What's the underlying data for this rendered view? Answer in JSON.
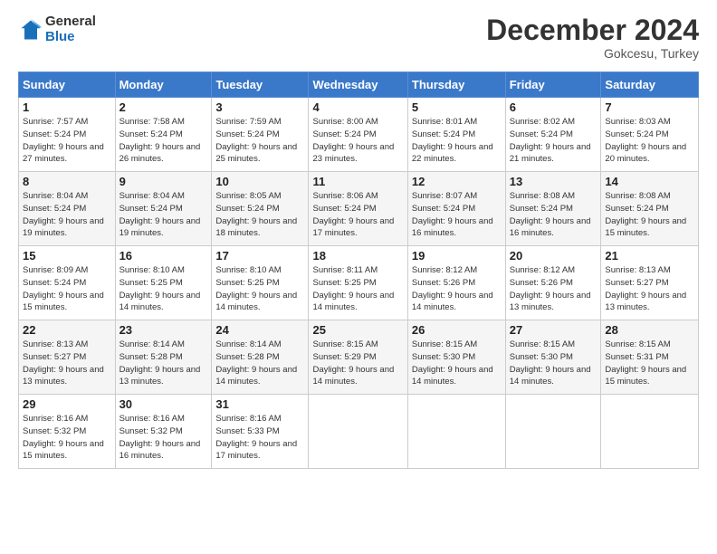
{
  "header": {
    "logo_line1": "General",
    "logo_line2": "Blue",
    "month": "December 2024",
    "location": "Gokcesu, Turkey"
  },
  "days_of_week": [
    "Sunday",
    "Monday",
    "Tuesday",
    "Wednesday",
    "Thursday",
    "Friday",
    "Saturday"
  ],
  "weeks": [
    [
      {
        "num": "1",
        "sunrise": "7:57 AM",
        "sunset": "5:24 PM",
        "daylight": "9 hours and 27 minutes."
      },
      {
        "num": "2",
        "sunrise": "7:58 AM",
        "sunset": "5:24 PM",
        "daylight": "9 hours and 26 minutes."
      },
      {
        "num": "3",
        "sunrise": "7:59 AM",
        "sunset": "5:24 PM",
        "daylight": "9 hours and 25 minutes."
      },
      {
        "num": "4",
        "sunrise": "8:00 AM",
        "sunset": "5:24 PM",
        "daylight": "9 hours and 23 minutes."
      },
      {
        "num": "5",
        "sunrise": "8:01 AM",
        "sunset": "5:24 PM",
        "daylight": "9 hours and 22 minutes."
      },
      {
        "num": "6",
        "sunrise": "8:02 AM",
        "sunset": "5:24 PM",
        "daylight": "9 hours and 21 minutes."
      },
      {
        "num": "7",
        "sunrise": "8:03 AM",
        "sunset": "5:24 PM",
        "daylight": "9 hours and 20 minutes."
      }
    ],
    [
      {
        "num": "8",
        "sunrise": "8:04 AM",
        "sunset": "5:24 PM",
        "daylight": "9 hours and 19 minutes."
      },
      {
        "num": "9",
        "sunrise": "8:04 AM",
        "sunset": "5:24 PM",
        "daylight": "9 hours and 19 minutes."
      },
      {
        "num": "10",
        "sunrise": "8:05 AM",
        "sunset": "5:24 PM",
        "daylight": "9 hours and 18 minutes."
      },
      {
        "num": "11",
        "sunrise": "8:06 AM",
        "sunset": "5:24 PM",
        "daylight": "9 hours and 17 minutes."
      },
      {
        "num": "12",
        "sunrise": "8:07 AM",
        "sunset": "5:24 PM",
        "daylight": "9 hours and 16 minutes."
      },
      {
        "num": "13",
        "sunrise": "8:08 AM",
        "sunset": "5:24 PM",
        "daylight": "9 hours and 16 minutes."
      },
      {
        "num": "14",
        "sunrise": "8:08 AM",
        "sunset": "5:24 PM",
        "daylight": "9 hours and 15 minutes."
      }
    ],
    [
      {
        "num": "15",
        "sunrise": "8:09 AM",
        "sunset": "5:24 PM",
        "daylight": "9 hours and 15 minutes."
      },
      {
        "num": "16",
        "sunrise": "8:10 AM",
        "sunset": "5:25 PM",
        "daylight": "9 hours and 14 minutes."
      },
      {
        "num": "17",
        "sunrise": "8:10 AM",
        "sunset": "5:25 PM",
        "daylight": "9 hours and 14 minutes."
      },
      {
        "num": "18",
        "sunrise": "8:11 AM",
        "sunset": "5:25 PM",
        "daylight": "9 hours and 14 minutes."
      },
      {
        "num": "19",
        "sunrise": "8:12 AM",
        "sunset": "5:26 PM",
        "daylight": "9 hours and 14 minutes."
      },
      {
        "num": "20",
        "sunrise": "8:12 AM",
        "sunset": "5:26 PM",
        "daylight": "9 hours and 13 minutes."
      },
      {
        "num": "21",
        "sunrise": "8:13 AM",
        "sunset": "5:27 PM",
        "daylight": "9 hours and 13 minutes."
      }
    ],
    [
      {
        "num": "22",
        "sunrise": "8:13 AM",
        "sunset": "5:27 PM",
        "daylight": "9 hours and 13 minutes."
      },
      {
        "num": "23",
        "sunrise": "8:14 AM",
        "sunset": "5:28 PM",
        "daylight": "9 hours and 13 minutes."
      },
      {
        "num": "24",
        "sunrise": "8:14 AM",
        "sunset": "5:28 PM",
        "daylight": "9 hours and 14 minutes."
      },
      {
        "num": "25",
        "sunrise": "8:15 AM",
        "sunset": "5:29 PM",
        "daylight": "9 hours and 14 minutes."
      },
      {
        "num": "26",
        "sunrise": "8:15 AM",
        "sunset": "5:30 PM",
        "daylight": "9 hours and 14 minutes."
      },
      {
        "num": "27",
        "sunrise": "8:15 AM",
        "sunset": "5:30 PM",
        "daylight": "9 hours and 14 minutes."
      },
      {
        "num": "28",
        "sunrise": "8:15 AM",
        "sunset": "5:31 PM",
        "daylight": "9 hours and 15 minutes."
      }
    ],
    [
      {
        "num": "29",
        "sunrise": "8:16 AM",
        "sunset": "5:32 PM",
        "daylight": "9 hours and 15 minutes."
      },
      {
        "num": "30",
        "sunrise": "8:16 AM",
        "sunset": "5:32 PM",
        "daylight": "9 hours and 16 minutes."
      },
      {
        "num": "31",
        "sunrise": "8:16 AM",
        "sunset": "5:33 PM",
        "daylight": "9 hours and 17 minutes."
      },
      null,
      null,
      null,
      null
    ]
  ]
}
